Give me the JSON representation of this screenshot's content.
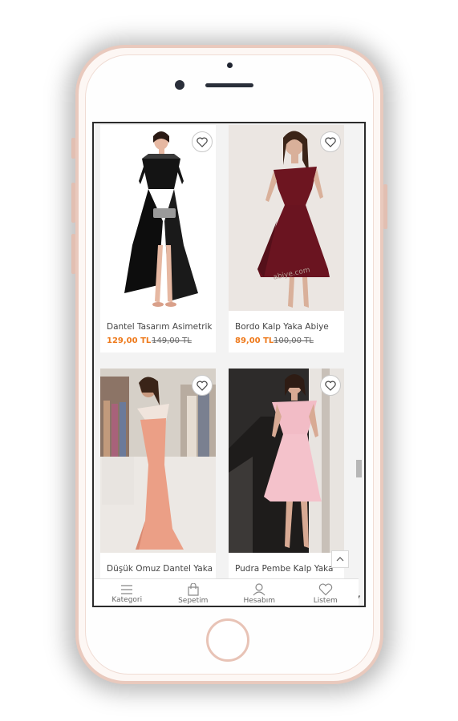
{
  "products": [
    {
      "title": "Dantel Tasarım Asimetrik",
      "price": "129,00 TL",
      "old_price": "149,00 TL"
    },
    {
      "title": "Bordo Kalp Yaka Abiye",
      "price": "89,00 TL",
      "old_price": "100,00 TL"
    },
    {
      "title": "Düşük Omuz Dantel Yaka",
      "price": "",
      "old_price": ""
    },
    {
      "title": "Pudra Pembe Kalp Yaka",
      "price": "",
      "old_price": ""
    }
  ],
  "bottom_nav": [
    {
      "label": "Kategori",
      "icon": "menu-icon"
    },
    {
      "label": "Sepetim",
      "icon": "bag-icon"
    },
    {
      "label": "Hesabım",
      "icon": "user-icon"
    },
    {
      "label": "Listem",
      "icon": "heart-icon"
    }
  ],
  "colors": {
    "price": "#ee7a1c",
    "accent": "#e9c9bd"
  }
}
